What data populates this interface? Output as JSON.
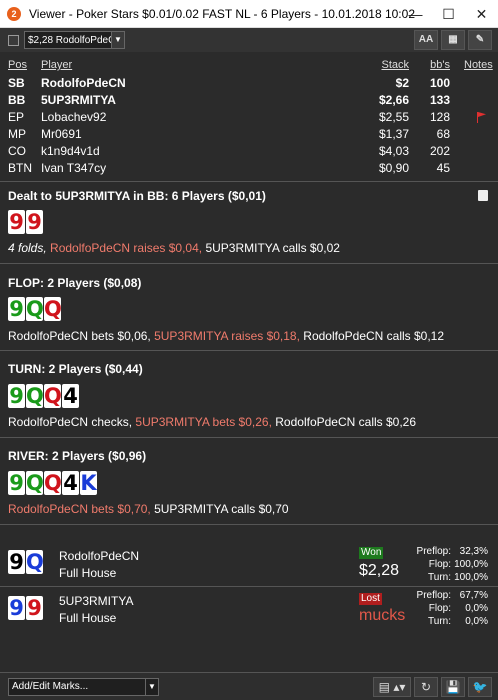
{
  "window": {
    "app_icon": "2",
    "title": "Viewer - Poker Stars $0.01/0.02 FAST NL - 6 Players - 10.01.2018 10:02",
    "minimize": "—",
    "maximize": "☐",
    "close": "✕"
  },
  "toolbar": {
    "hand_select": "$2,28 RodolfoPdeCN",
    "font_button": "AA",
    "grid_button": "▦",
    "edit_button": "✎"
  },
  "players_table": {
    "headers": {
      "pos": "Pos",
      "player": "Player",
      "stack": "Stack",
      "bbs": "bb's",
      "notes": "Notes"
    },
    "rows": [
      {
        "pos": "SB",
        "player": "RodolfoPdeCN",
        "stack": "$2",
        "bbs": "100"
      },
      {
        "pos": "BB",
        "player": "5UP3RMITYA",
        "stack": "$2,66",
        "bbs": "133"
      },
      {
        "pos": "EP",
        "player": "Lobachev92",
        "stack": "$2,55",
        "bbs": "128"
      },
      {
        "pos": "MP",
        "player": "Mr0691",
        "stack": "$1,37",
        "bbs": "68"
      },
      {
        "pos": "CO",
        "player": "k1n9d4v1d",
        "stack": "$4,03",
        "bbs": "202"
      },
      {
        "pos": "BTN",
        "player": "Ivan T347cy",
        "stack": "$0,90",
        "bbs": "45"
      }
    ]
  },
  "preflop": {
    "title": "Dealt to 5UP3RMITYA in BB: 6 Players ($0,01)",
    "cards": [
      {
        "rank": "9",
        "suit": "h"
      },
      {
        "rank": "9",
        "suit": "h"
      }
    ],
    "a1": "4 folds, ",
    "a2": "RodolfoPdeCN raises $0,04, ",
    "a3": "5UP3RMITYA calls $0,02"
  },
  "flop": {
    "title": "FLOP: 2 Players ($0,08)",
    "cards": [
      {
        "rank": "9",
        "suit": "c"
      },
      {
        "rank": "Q",
        "suit": "c"
      },
      {
        "rank": "Q",
        "suit": "h"
      }
    ],
    "a1": "RodolfoPdeCN bets $0,06, ",
    "a2": "5UP3RMITYA raises $0,18, ",
    "a3": "RodolfoPdeCN calls $0,12"
  },
  "turn": {
    "title": "TURN: 2 Players ($0,44)",
    "cards": [
      {
        "rank": "9",
        "suit": "c"
      },
      {
        "rank": "Q",
        "suit": "c"
      },
      {
        "rank": "Q",
        "suit": "h"
      },
      {
        "rank": "4",
        "suit": "s"
      }
    ],
    "a1": "RodolfoPdeCN checks, ",
    "a2": "5UP3RMITYA bets $0,26, ",
    "a3": "RodolfoPdeCN calls $0,26"
  },
  "river": {
    "title": "RIVER: 2 Players ($0,96)",
    "cards": [
      {
        "rank": "9",
        "suit": "c"
      },
      {
        "rank": "Q",
        "suit": "c"
      },
      {
        "rank": "Q",
        "suit": "h"
      },
      {
        "rank": "4",
        "suit": "s"
      },
      {
        "rank": "K",
        "suit": "d"
      }
    ],
    "a1": "RodolfoPdeCN bets $0,70, ",
    "a2": "5UP3RMITYA calls $0,70"
  },
  "showdown": [
    {
      "cards": [
        {
          "rank": "9",
          "suit": "s"
        },
        {
          "rank": "Q",
          "suit": "d"
        }
      ],
      "name": "RodolfoPdeCN",
      "hand": "Full House",
      "result": "Won",
      "amount": "$2,28",
      "stats": [
        {
          "label": "Preflop:",
          "value": "32,3%"
        },
        {
          "label": "Flop:",
          "value": "100,0%"
        },
        {
          "label": "Turn:",
          "value": "100,0%"
        }
      ]
    },
    {
      "cards": [
        {
          "rank": "9",
          "suit": "d"
        },
        {
          "rank": "9",
          "suit": "h"
        }
      ],
      "name": "5UP3RMITYA",
      "hand": "Full House",
      "result": "Lost",
      "amount": "mucks",
      "stats": [
        {
          "label": "Preflop:",
          "value": "67,7%"
        },
        {
          "label": "Flop:",
          "value": "0,0%"
        },
        {
          "label": "Turn:",
          "value": "0,0%"
        }
      ]
    }
  ],
  "bottom": {
    "marks_select": "Add/Edit Marks...",
    "report_button": "▤ ▴▾",
    "replay_button": "↻",
    "save_button": "💾",
    "twitter_button": "🐦"
  },
  "colors": {
    "hearts": "#d0141c",
    "clubs": "#1a9a1a",
    "diamonds": "#1a3cd8",
    "spades": "#000000",
    "action_red": "#f07b6c",
    "won": "#1e7a1e",
    "lost": "#b01e1e"
  }
}
